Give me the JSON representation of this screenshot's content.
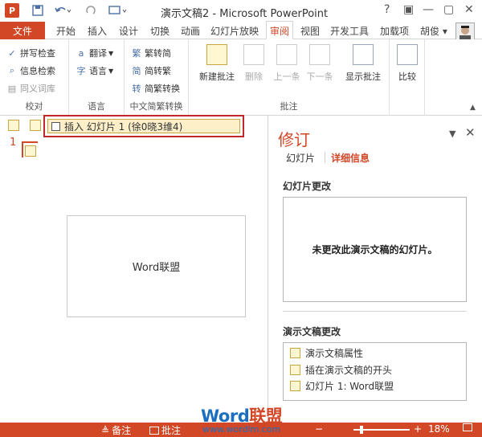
{
  "window": {
    "title": "演示文稿2 - Microsoft PowerPoint",
    "app_icon_label": "P",
    "controls": [
      "?",
      "▣",
      "—",
      "▢",
      "✕"
    ]
  },
  "quick_access": {
    "icons": [
      "save-icon",
      "undo-icon",
      "redo-icon",
      "start-presentation-icon"
    ]
  },
  "tabs": {
    "file": "文件",
    "items": [
      "开始",
      "插入",
      "设计",
      "切换",
      "动画",
      "幻灯片放映",
      "审阅",
      "视图",
      "开发工具",
      "加载项"
    ],
    "active": "审阅",
    "user": "胡俊 ▾"
  },
  "ribbon": {
    "proofing": {
      "caption": "校对",
      "spell_check": "拼写检查",
      "research": "信息检索",
      "thesaurus": "同义词库"
    },
    "language": {
      "caption": "语言",
      "translate": "翻译",
      "language": "语言"
    },
    "chinese_conversion": {
      "caption": "中文简繁转换",
      "to_simplified": "繁转简",
      "to_traditional": "简转繁",
      "conversion": "简繁转换"
    },
    "comments": {
      "caption": "批注",
      "new_comment": "新建批注",
      "delete": "删除",
      "previous": "上一条",
      "next": "下一条",
      "show_comments": "显示批注"
    },
    "compare": {
      "caption": "比较",
      "compare": "比较"
    }
  },
  "slide_pane": {
    "slide_number": "1"
  },
  "change_marker": {
    "text": "插入 幻灯片 1 (徐0晓3维4)"
  },
  "slide": {
    "text": "Word联盟"
  },
  "revisions_pane": {
    "title": "修订",
    "tab_slides": "幻灯片",
    "tab_details": "详细信息",
    "slide_changes_header": "幻灯片更改",
    "slide_changes_message": "未更改此演示文稿的幻灯片。",
    "presentation_changes_header": "演示文稿更改",
    "presentation_changes": [
      "演示文稿属性",
      "插在演示文稿的开头",
      "幻灯片 1: Word联盟"
    ]
  },
  "status_bar": {
    "notes": "备注",
    "comments": "批注",
    "zoom": "18%"
  },
  "watermark": {
    "brand_a": "Word",
    "brand_b": "联盟",
    "url": "www.wordlm.com"
  },
  "colors": {
    "accent": "#D24726",
    "highlight_border": "#C1272D"
  }
}
